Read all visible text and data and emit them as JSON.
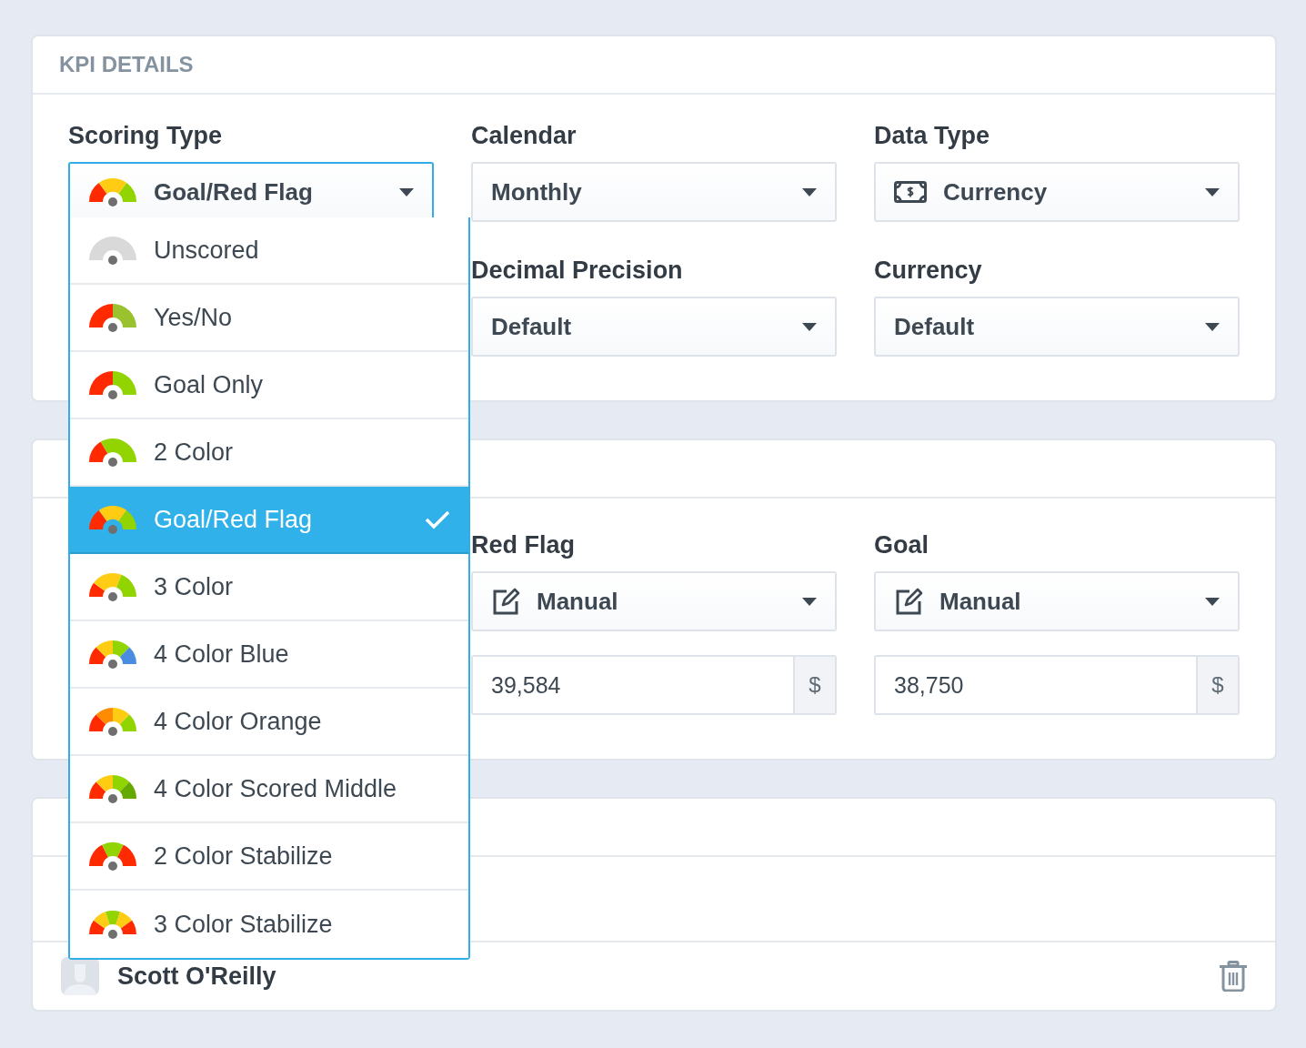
{
  "kpi_details": {
    "title": "KPI DETAILS",
    "row_1": [
      {
        "label": "Scoring Type",
        "value": "Goal/Red Flag",
        "kind": "goal-red-flag",
        "expanded": true,
        "options": [
          {
            "label": "Unscored",
            "kind": "unscored",
            "selected": false
          },
          {
            "label": "Yes/No",
            "kind": "yes-no",
            "selected": false
          },
          {
            "label": "Goal Only",
            "kind": "goal-only",
            "selected": false
          },
          {
            "label": "2 Color",
            "kind": "two-color",
            "selected": false
          },
          {
            "label": "Goal/Red Flag",
            "kind": "goal-red-flag",
            "selected": true
          },
          {
            "label": "3 Color",
            "kind": "three-color",
            "selected": false
          },
          {
            "label": "4 Color Blue",
            "kind": "four-blue",
            "selected": false
          },
          {
            "label": "4 Color Orange",
            "kind": "four-orange",
            "selected": false
          },
          {
            "label": "4 Color Scored Middle",
            "kind": "four-middle",
            "selected": false
          },
          {
            "label": "2 Color Stabilize",
            "kind": "two-stabilize",
            "selected": false
          },
          {
            "label": "3 Color Stabilize",
            "kind": "three-stabilize",
            "selected": false
          }
        ]
      },
      {
        "label": "Calendar",
        "value": "Monthly",
        "expanded": false
      },
      {
        "label": "Data Type",
        "value": "Currency",
        "kind": "money",
        "expanded": false
      }
    ],
    "row_2": [
      {
        "label": "Decimal Precision",
        "value": "Default",
        "expanded": false
      },
      {
        "label": "Currency",
        "value": "Default",
        "expanded": false
      }
    ]
  },
  "scoring": {
    "fields": [
      {
        "label": "Red Flag",
        "value": "Manual",
        "kind": "edit",
        "expanded": false,
        "amount": "39,584",
        "addon": "$"
      },
      {
        "label": "Goal",
        "value": "Manual",
        "kind": "edit",
        "expanded": false,
        "amount": "38,750",
        "addon": "$"
      }
    ]
  },
  "owners": {
    "user": {
      "name": "Scott O'Reilly"
    }
  }
}
